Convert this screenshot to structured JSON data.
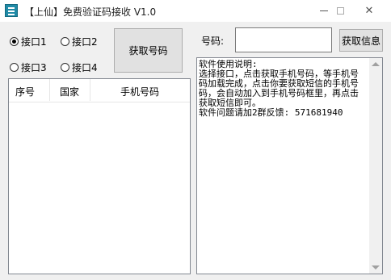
{
  "window": {
    "title": "【上仙】免费验证码接收 V1.0"
  },
  "radios": [
    {
      "label": "接口1",
      "checked": true
    },
    {
      "label": "接口2",
      "checked": false
    },
    {
      "label": "接口3",
      "checked": false
    },
    {
      "label": "接口4",
      "checked": false
    }
  ],
  "buttons": {
    "get_number": "获取号码",
    "get_message": "获取信息"
  },
  "number_field": {
    "label": "号码:",
    "value": ""
  },
  "table": {
    "columns": [
      "序号",
      "国家",
      "手机号码"
    ],
    "rows": []
  },
  "memo": {
    "text": "软件使用说明:\n选择接口，点击获取手机号码，等手机号码加载完成，点击你要获取短信的手机号码，会自动加入到手机号码框里，再点击获取短信即可。\n软件问题请加2群反馈: 571681940"
  }
}
